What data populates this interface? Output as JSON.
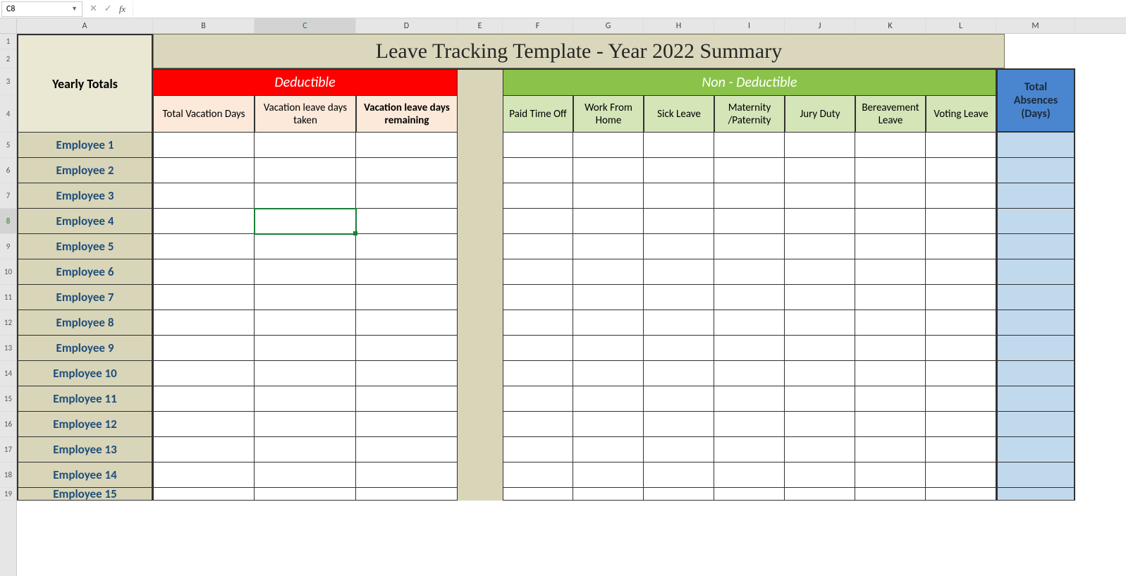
{
  "name_box": "C8",
  "formula": "",
  "columns": [
    "A",
    "B",
    "C",
    "D",
    "E",
    "F",
    "G",
    "H",
    "I",
    "J",
    "K",
    "L",
    "M"
  ],
  "rows": [
    1,
    2,
    3,
    4,
    5,
    6,
    7,
    8,
    9,
    10,
    11,
    12,
    13,
    14,
    15,
    16,
    17,
    18,
    19
  ],
  "title": "Leave Tracking Template - Year 2022 Summary",
  "yearly_totals": "Yearly Totals",
  "deductible": "Deductible",
  "non_deductible": "Non - Deductible",
  "total_absences": "Total Absences (Days)",
  "sub_ded": {
    "b": "Total Vacation Days",
    "c": "Vacation leave days taken",
    "d": "Vacation leave days remaining"
  },
  "sub_non": {
    "f": "Paid Time Off",
    "g": "Work From Home",
    "h": "Sick Leave",
    "i": "Maternity /Paternity",
    "j": "Jury Duty",
    "k": "Bereavement Leave",
    "l": "Voting Leave"
  },
  "employees": [
    "Employee 1",
    "Employee 2",
    "Employee 3",
    "Employee 4",
    "Employee 5",
    "Employee 6",
    "Employee 7",
    "Employee 8",
    "Employee 9",
    "Employee 10",
    "Employee 11",
    "Employee 12",
    "Employee 13",
    "Employee 14",
    "Employee 15"
  ],
  "selected_cell": "C8",
  "chart_data": {
    "type": "table",
    "title": "Leave Tracking Template - Year 2022 Summary",
    "row_labels": [
      "Employee 1",
      "Employee 2",
      "Employee 3",
      "Employee 4",
      "Employee 5",
      "Employee 6",
      "Employee 7",
      "Employee 8",
      "Employee 9",
      "Employee 10",
      "Employee 11",
      "Employee 12",
      "Employee 13",
      "Employee 14",
      "Employee 15"
    ],
    "columns": [
      "Total Vacation Days",
      "Vacation leave days taken",
      "Vacation leave days remaining",
      "Paid Time Off",
      "Work From Home",
      "Sick Leave",
      "Maternity /Paternity",
      "Jury Duty",
      "Bereavement Leave",
      "Voting Leave",
      "Total Absences (Days)"
    ],
    "values": []
  }
}
